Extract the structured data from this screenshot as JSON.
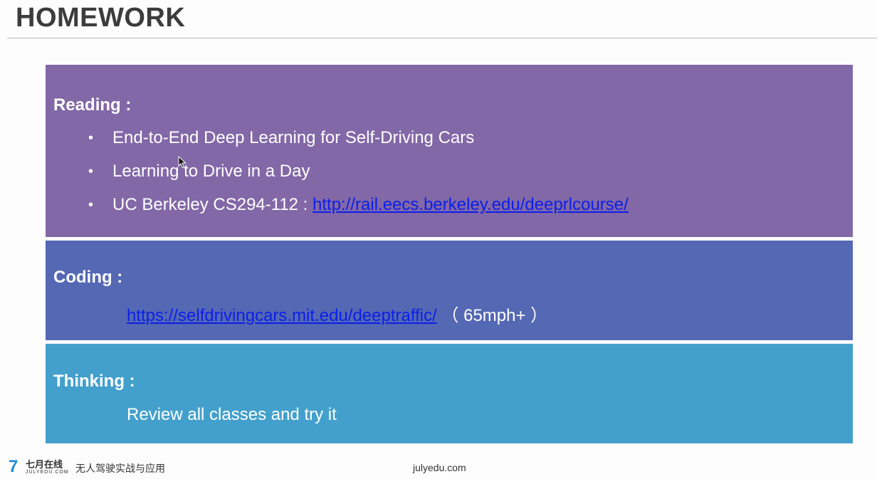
{
  "slide": {
    "title": "HOMEWORK"
  },
  "reading": {
    "heading": "Reading :",
    "items": [
      {
        "text": "End-to-End Deep Learning for Self-Driving Cars",
        "link": ""
      },
      {
        "text": "Learning to Drive in a Day",
        "link": ""
      },
      {
        "text": "UC Berkeley CS294-112 : ",
        "link": "http://rail.eecs.berkeley.edu/deeprlcourse/"
      }
    ]
  },
  "coding": {
    "heading": "Coding :",
    "link": "https://selfdrivingcars.mit.edu/deeptraffic/",
    "suffix": " （ 65mph+ ）"
  },
  "thinking": {
    "heading": "Thinking :",
    "text": "Review all classes and try it"
  },
  "footer": {
    "logo_cn": "七月在线",
    "logo_en": "JULYEDU.COM",
    "course": "无人驾驶实战与应用",
    "site": "julyedu.com"
  },
  "colors": {
    "reading_panel": "#8268a7",
    "coding_panel": "#5468b4",
    "thinking_panel": "#43a0cc",
    "link": "#0b1fe8"
  }
}
